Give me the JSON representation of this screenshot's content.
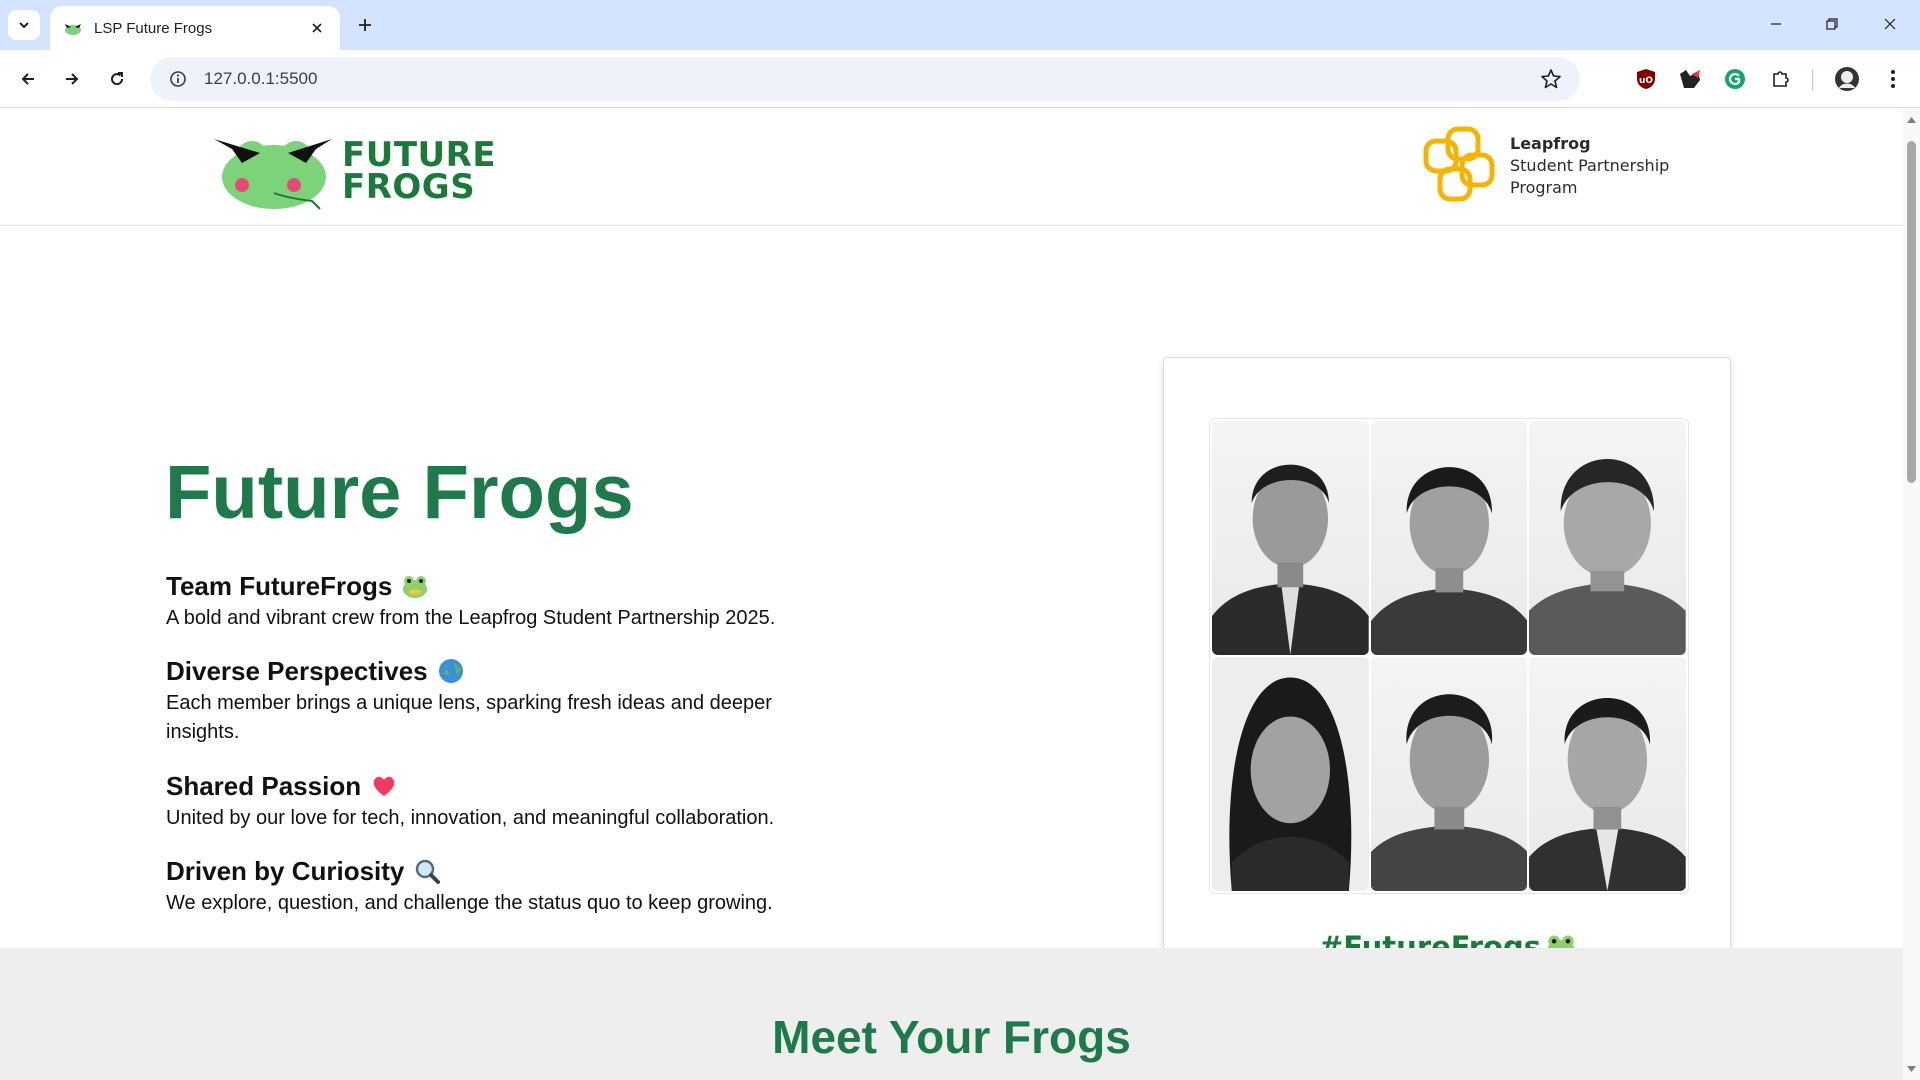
{
  "browser": {
    "tab_title": "LSP Future Frogs",
    "url": "127.0.0.1:5500"
  },
  "header": {
    "logo_line1": "FUTURE",
    "logo_line2": "FROGS",
    "partner_line1": "Leapfrog",
    "partner_line2": "Student Partnership",
    "partner_line3": "Program"
  },
  "hero": {
    "title": "Future Frogs",
    "features": [
      {
        "heading": "Team FutureFrogs",
        "emoji": "frog-emoji",
        "text": "A bold and vibrant crew from the Leapfrog Student Partnership 2025."
      },
      {
        "heading": "Diverse Perspectives",
        "emoji": "globe-emoji",
        "text": "Each member brings a unique lens, sparking fresh ideas and deeper insights."
      },
      {
        "heading": "Shared Passion",
        "emoji": "heart-emoji",
        "text": "United by our love for tech, innovation, and meaningful collaboration."
      },
      {
        "heading": "Driven by Curiosity",
        "emoji": "magnifier-emoji",
        "text": "We explore, question, and challenge the status quo to keep growing."
      }
    ],
    "hashtag": "#FutureFrogs"
  },
  "meet": {
    "title": "Meet Your Frogs"
  },
  "colors": {
    "brand_green": "#1e7a4a",
    "leapfrog_orange": "#f4b400",
    "tabbar_bg": "#d3e3fd"
  }
}
